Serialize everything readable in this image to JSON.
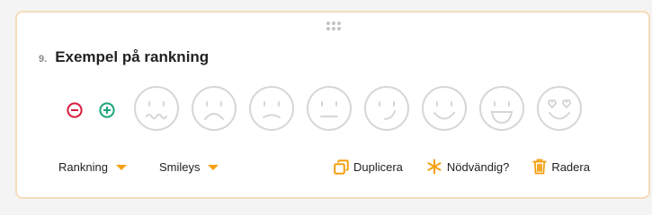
{
  "question": {
    "number": "9.",
    "title": "Exempel på rankning"
  },
  "controls": {
    "remove_icon": "minus-circle-icon",
    "add_icon": "plus-circle-icon"
  },
  "smileys": [
    {
      "icon": "nauseated-face-icon"
    },
    {
      "icon": "frowning-face-icon"
    },
    {
      "icon": "slightly-frowning-face-icon"
    },
    {
      "icon": "neutral-face-icon"
    },
    {
      "icon": "smirking-face-icon"
    },
    {
      "icon": "smiling-face-icon"
    },
    {
      "icon": "grinning-face-icon"
    },
    {
      "icon": "heart-eyes-face-icon"
    }
  ],
  "footer": {
    "type_dropdown": "Rankning",
    "style_dropdown": "Smileys",
    "duplicate_label": "Duplicera",
    "required_label": "Nödvändig?",
    "delete_label": "Radera"
  },
  "colors": {
    "accent": "#f5a011",
    "remove": "#d81b3c",
    "add": "#1aa57a",
    "smiley_stroke": "#d6d6d6",
    "card_border": "#f5dcb9"
  }
}
